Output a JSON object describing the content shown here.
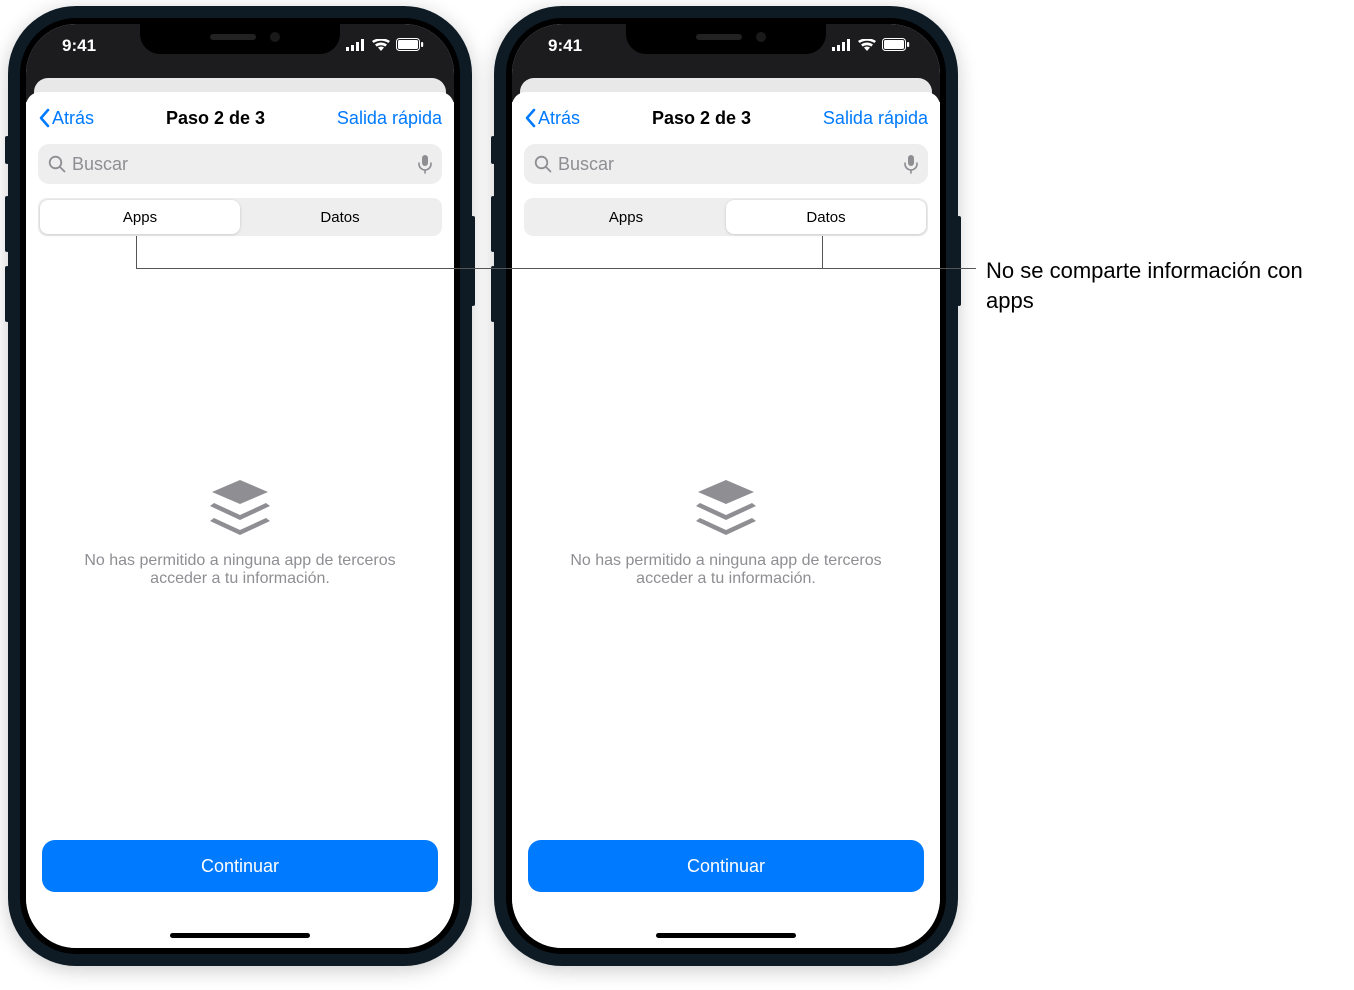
{
  "status": {
    "time": "9:41"
  },
  "nav": {
    "back": "Atrás",
    "title": "Paso 2 de 3",
    "quick_exit": "Salida rápida"
  },
  "search": {
    "placeholder": "Buscar"
  },
  "tabs": {
    "apps": "Apps",
    "data": "Datos"
  },
  "empty": {
    "message": "No has permitido a ninguna app de terceros acceder a tu información."
  },
  "cta": {
    "continue": "Continuar"
  },
  "callout": {
    "text": "No se comparte información con apps"
  }
}
